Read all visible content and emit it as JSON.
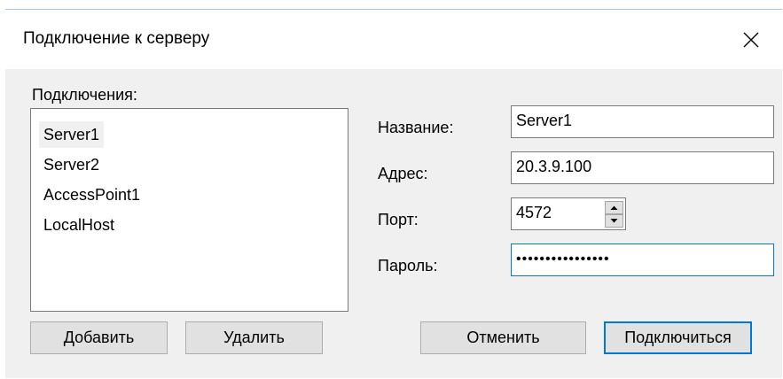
{
  "dialog": {
    "title": "Подключение к серверу",
    "close_icon": "close-icon"
  },
  "connections": {
    "label": "Подключения:",
    "items": [
      {
        "label": "Server1",
        "selected": true
      },
      {
        "label": "Server2",
        "selected": false
      },
      {
        "label": "AccessPoint1",
        "selected": false
      },
      {
        "label": "LocalHost",
        "selected": false
      }
    ]
  },
  "form": {
    "name_label": "Название:",
    "name_value": "Server1",
    "address_label": "Адрес:",
    "address_value": "20.3.9.100",
    "port_label": "Порт:",
    "port_value": "4572",
    "password_label": "Пароль:",
    "password_mask": "••••••••••••••••"
  },
  "buttons": {
    "add": "Добавить",
    "delete": "Удалить",
    "cancel": "Отменить",
    "connect": "Подключиться"
  },
  "colors": {
    "focus_border": "#0078d7",
    "button_face": "#e1e1e1",
    "dialog_bg": "#f0f0f0"
  }
}
